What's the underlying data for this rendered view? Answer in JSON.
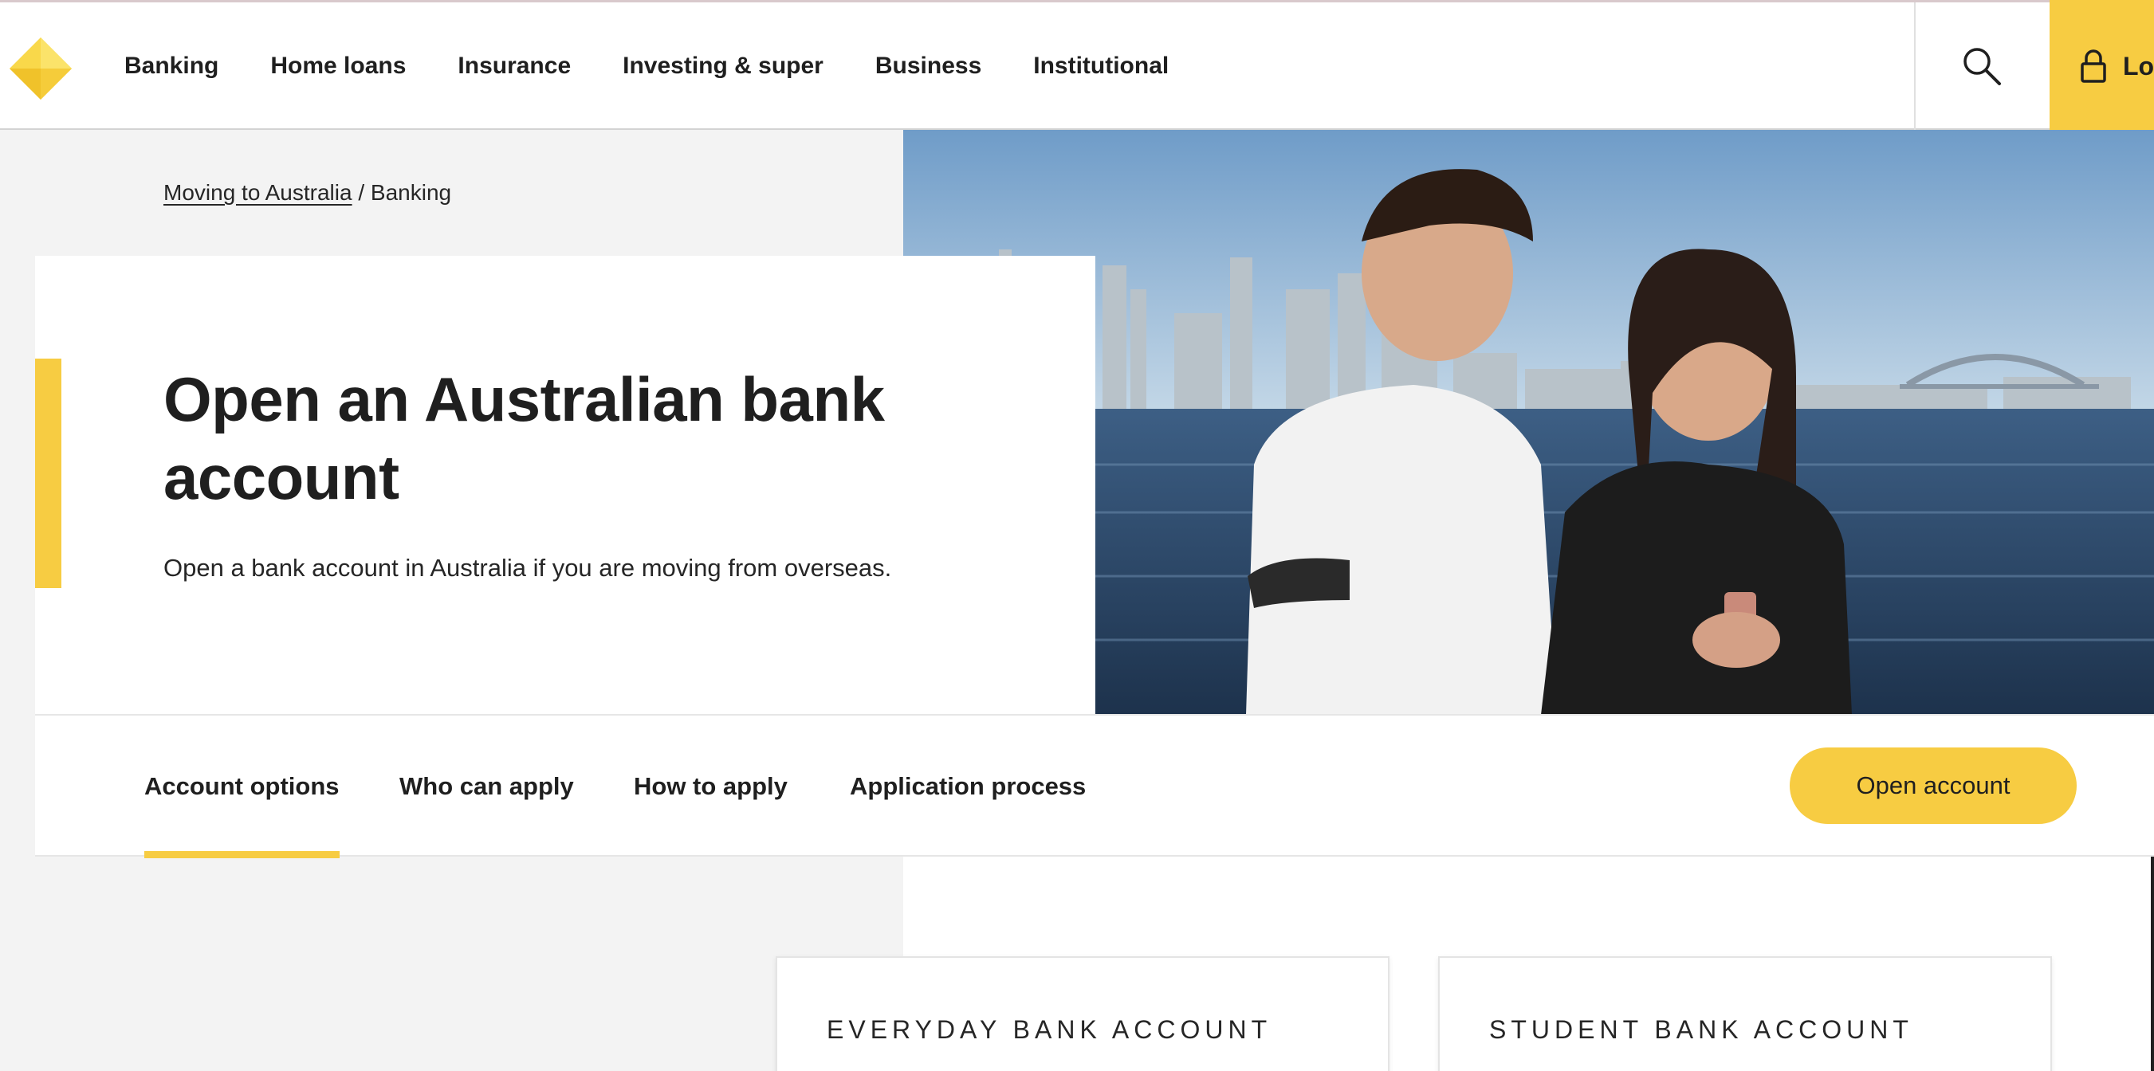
{
  "brand": {
    "accent": "#f7cc42",
    "text": "#1f1f1f",
    "muted_bg": "#f3f3f3"
  },
  "nav": {
    "items": [
      {
        "label": "Banking"
      },
      {
        "label": "Home loans"
      },
      {
        "label": "Insurance"
      },
      {
        "label": "Investing & super"
      },
      {
        "label": "Business"
      },
      {
        "label": "Institutional"
      }
    ],
    "search_icon": "search-icon",
    "login_icon": "lock-icon",
    "login_label": "Lo"
  },
  "breadcrumb": {
    "link": "Moving to Australia",
    "separator": " / ",
    "current": "Banking"
  },
  "hero": {
    "title": "Open an Australian bank account",
    "subtitle": "Open a bank account in Australia if you are moving from overseas."
  },
  "tabs": {
    "items": [
      {
        "label": "Account options",
        "active": true
      },
      {
        "label": "Who can apply",
        "active": false
      },
      {
        "label": "How to apply",
        "active": false
      },
      {
        "label": "Application process",
        "active": false
      }
    ],
    "cta": "Open account"
  },
  "cards": [
    {
      "title": "EVERYDAY BANK ACCOUNT"
    },
    {
      "title": "STUDENT BANK ACCOUNT"
    }
  ]
}
